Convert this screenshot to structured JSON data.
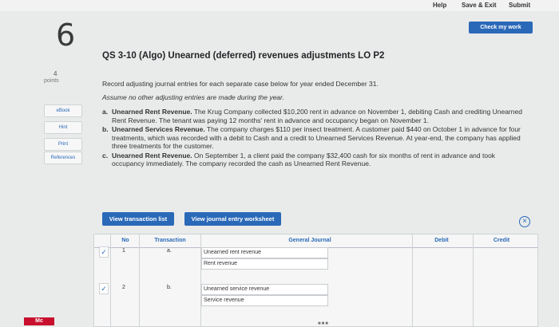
{
  "topbar": {
    "help": "Help",
    "save_exit": "Save & Exit",
    "submit": "Submit"
  },
  "check_button": "Check my work",
  "question": {
    "number": "6",
    "points_value": "4",
    "points_label": "points",
    "title": "QS 3-10 (Algo) Unearned (deferred) revenues adjustments LO P2",
    "instruction": "Record adjusting journal entries for each separate case below for year ended December 31.",
    "assumption": "Assume no other adjusting entries are made during the year."
  },
  "side_buttons": [
    {
      "label": "eBook"
    },
    {
      "label": "Hint"
    },
    {
      "label": "Print"
    },
    {
      "label": "References"
    }
  ],
  "cases": [
    {
      "letter": "a.",
      "title": "Unearned Rent Revenue.",
      "text": "The Krug Company collected $10,200 rent in advance on November 1, debiting Cash and crediting Unearned Rent Revenue. The tenant was paying 12 months' rent in advance and occupancy began on November 1."
    },
    {
      "letter": "b.",
      "title": "Unearned Services Revenue.",
      "text": "The company charges $110 per insect treatment. A customer paid $440 on October 1 in advance for four treatments, which was recorded with a debit to Cash and a credit to Unearned Services Revenue. At year-end, the company has applied three treatments for the customer."
    },
    {
      "letter": "c.",
      "title": "Unearned Rent Revenue.",
      "text": "On September 1, a client paid the company $32,400 cash for six months of rent in advance and took occupancy immediately. The company recorded the cash as Unearned Rent Revenue."
    }
  ],
  "tabs": {
    "view_transaction_list": "View transaction list",
    "view_journal_worksheet": "View journal entry worksheet"
  },
  "table": {
    "headers": {
      "no": "No",
      "transaction": "Transaction",
      "general_journal": "General Journal",
      "debit": "Debit",
      "credit": "Credit"
    },
    "rows": [
      {
        "no": "1",
        "transaction": "a.",
        "debit_account": "Unearned rent revenue",
        "credit_account": "Rent revenue"
      },
      {
        "no": "2",
        "transaction": "b.",
        "debit_account": "Unearned service revenue",
        "credit_account": "Service revenue"
      }
    ]
  },
  "logo_text": "Mc",
  "pagination_dots": "■■■"
}
